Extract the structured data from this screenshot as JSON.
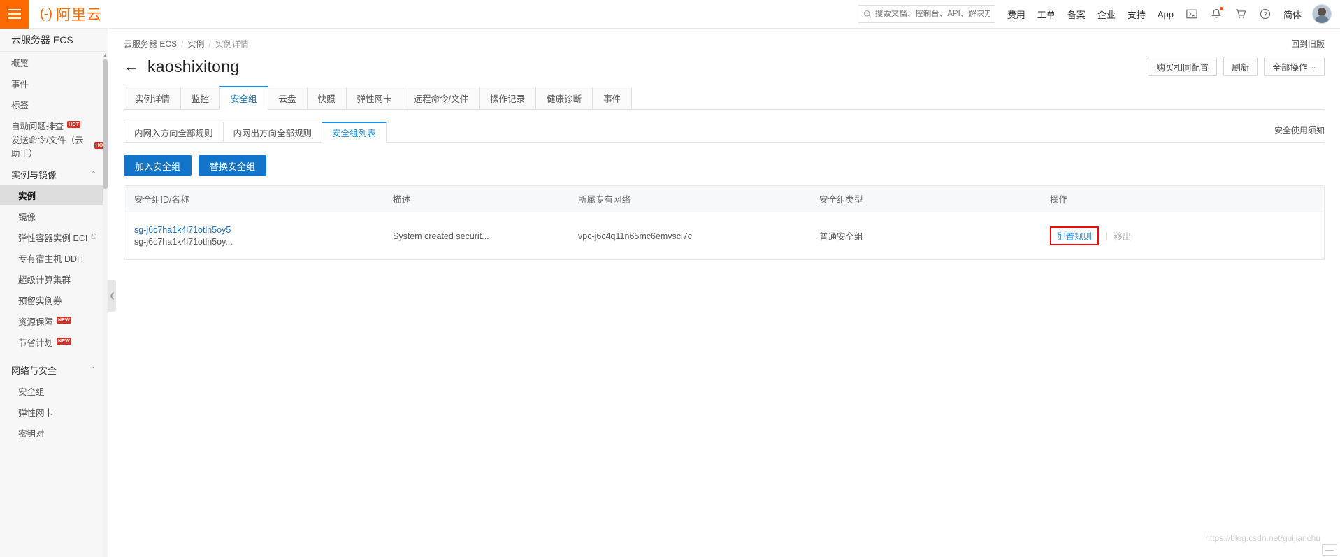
{
  "topbar": {
    "menu_icon": "hamburger-icon",
    "logo_mark": "(-)",
    "logo_text": "阿里云",
    "search": {
      "icon": "search-icon",
      "placeholder": "搜索文档、控制台、API、解决方案和资源",
      "value": ""
    },
    "links": [
      {
        "label": "费用"
      },
      {
        "label": "工单"
      },
      {
        "label": "备案"
      },
      {
        "label": "企业"
      },
      {
        "label": "支持"
      },
      {
        "label": "App"
      }
    ],
    "icons": [
      {
        "name": "terminal-icon",
        "glyph": "⧉"
      },
      {
        "name": "bell-icon",
        "glyph": "⚑",
        "has_dot": true
      },
      {
        "name": "cart-icon",
        "glyph": "Ὥ2"
      },
      {
        "name": "help-icon",
        "glyph": "?"
      }
    ],
    "language": "简体",
    "avatar": "avatar"
  },
  "sidebar": {
    "title": "云服务器 ECS",
    "items": [
      {
        "label": "概览",
        "type": "item"
      },
      {
        "label": "事件",
        "type": "item"
      },
      {
        "label": "标签",
        "type": "item"
      },
      {
        "label": "自动问题排查",
        "type": "item",
        "badge": "HOT"
      },
      {
        "label": "发送命令/文件（云助手）",
        "type": "item",
        "badge": "HOT"
      },
      {
        "label": "实例与镜像",
        "type": "group",
        "chevron": "⌃"
      },
      {
        "label": "实例",
        "type": "sub",
        "selected": true
      },
      {
        "label": "镜像",
        "type": "sub"
      },
      {
        "label": "弹性容器实例 ECI",
        "type": "sub",
        "external": true
      },
      {
        "label": "专有宿主机 DDH",
        "type": "sub"
      },
      {
        "label": "超级计算集群",
        "type": "sub"
      },
      {
        "label": "预留实例券",
        "type": "sub"
      },
      {
        "label": "资源保障",
        "type": "sub",
        "badge": "NEW"
      },
      {
        "label": "节省计划",
        "type": "sub",
        "badge": "NEW"
      },
      {
        "label": "网络与安全",
        "type": "group",
        "chevron": "⌃"
      },
      {
        "label": "安全组",
        "type": "sub"
      },
      {
        "label": "弹性网卡",
        "type": "sub"
      },
      {
        "label": "密钥对",
        "type": "sub"
      }
    ]
  },
  "breadcrumb": {
    "items": [
      "云服务器 ECS",
      "实例",
      "实例详情"
    ],
    "separator": "/"
  },
  "header": {
    "back_icon": "back-arrow-icon",
    "title": "kaoshixitong",
    "old_version_link": "回到旧版",
    "actions": [
      {
        "label": "购买相同配置"
      },
      {
        "label": "刷新"
      },
      {
        "label": "全部操作",
        "chevron": "⌄"
      }
    ]
  },
  "tabs": [
    {
      "label": "实例详情",
      "active": false
    },
    {
      "label": "监控",
      "active": false
    },
    {
      "label": "安全组",
      "active": true
    },
    {
      "label": "云盘",
      "active": false
    },
    {
      "label": "快照",
      "active": false
    },
    {
      "label": "弹性网卡",
      "active": false
    },
    {
      "label": "远程命令/文件",
      "active": false
    },
    {
      "label": "操作记录",
      "active": false
    },
    {
      "label": "健康诊断",
      "active": false
    },
    {
      "label": "事件",
      "active": false
    }
  ],
  "subtabs": [
    {
      "label": "内网入方向全部规则",
      "active": false
    },
    {
      "label": "内网出方向全部规则",
      "active": false
    },
    {
      "label": "安全组列表",
      "active": true
    }
  ],
  "secure_notice_link": "安全使用须知",
  "action_buttons": [
    {
      "label": "加入安全组"
    },
    {
      "label": "替换安全组"
    }
  ],
  "table": {
    "columns": [
      "安全组ID/名称",
      "描述",
      "所属专有网络",
      "安全组类型",
      "操作"
    ],
    "rows": [
      {
        "sg_id": "sg-j6c7ha1k4l71otln5oy5",
        "sg_name": "sg-j6c7ha1k4l71otln5oy...",
        "description": "System created securit...",
        "vpc": "vpc-j6c4q11n65mc6emvsci7c",
        "sg_type": "普通安全组",
        "operations": [
          {
            "label": "配置规则",
            "enabled": true,
            "highlighted": true
          },
          {
            "label": "移出",
            "enabled": false,
            "highlighted": false
          }
        ]
      }
    ]
  },
  "watermark": "https://blog.csdn.net/guijianchu",
  "colors": {
    "brand_orange": "#ff6a00",
    "link_blue": "#1a8fe3",
    "primary_button": "#1275c9",
    "annotation_red": "#f20d0d",
    "badge_red": "#d93026"
  }
}
